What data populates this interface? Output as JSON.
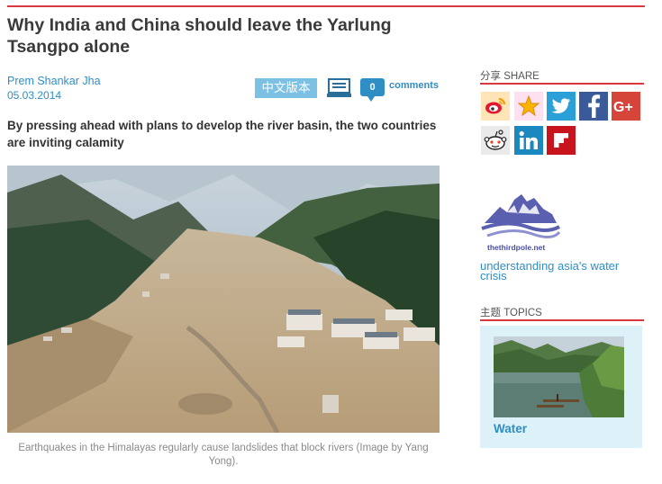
{
  "article": {
    "title": "Why India and China should leave the Yarlung Tsangpo alone",
    "author": "Prem Shankar Jha",
    "date": "05.03.2014",
    "chinese_version_label": "中文版本",
    "comment_count": "0",
    "comments_label": "comments",
    "standfirst": "By pressing ahead with plans to develop the river basin, the two countries are inviting calamity",
    "image_caption": "Earthquakes in the Himalayas regularly cause landslides that block rivers (Image by Yang Yong)."
  },
  "sidebar": {
    "share_heading": "分享 SHARE",
    "share_buttons": [
      {
        "icon": "weibo-icon",
        "color": "#ffe4b8"
      },
      {
        "icon": "qzone-star-icon",
        "color": "#ffe0f0"
      },
      {
        "icon": "twitter-icon",
        "color": "#2b9fd8"
      },
      {
        "icon": "facebook-icon",
        "color": "#3b5a9a"
      },
      {
        "icon": "google-plus-icon",
        "color": "#d6453a"
      },
      {
        "icon": "reddit-icon",
        "color": "#eaeaea"
      },
      {
        "icon": "linkedin-icon",
        "color": "#1c88c0"
      },
      {
        "icon": "flipboard-icon",
        "color": "#c8151d"
      }
    ],
    "logo_text": "thethirdpole.net",
    "tagline_link": "understanding asia's water crisis",
    "topics_heading": "主题 TOPICS",
    "topic_label": "Water"
  },
  "colors": {
    "accent_red": "#d9393e",
    "link_blue": "#2f8ec4",
    "chinese_button": "#7cc1e4",
    "topic_card_bg": "#ddf1f8"
  }
}
